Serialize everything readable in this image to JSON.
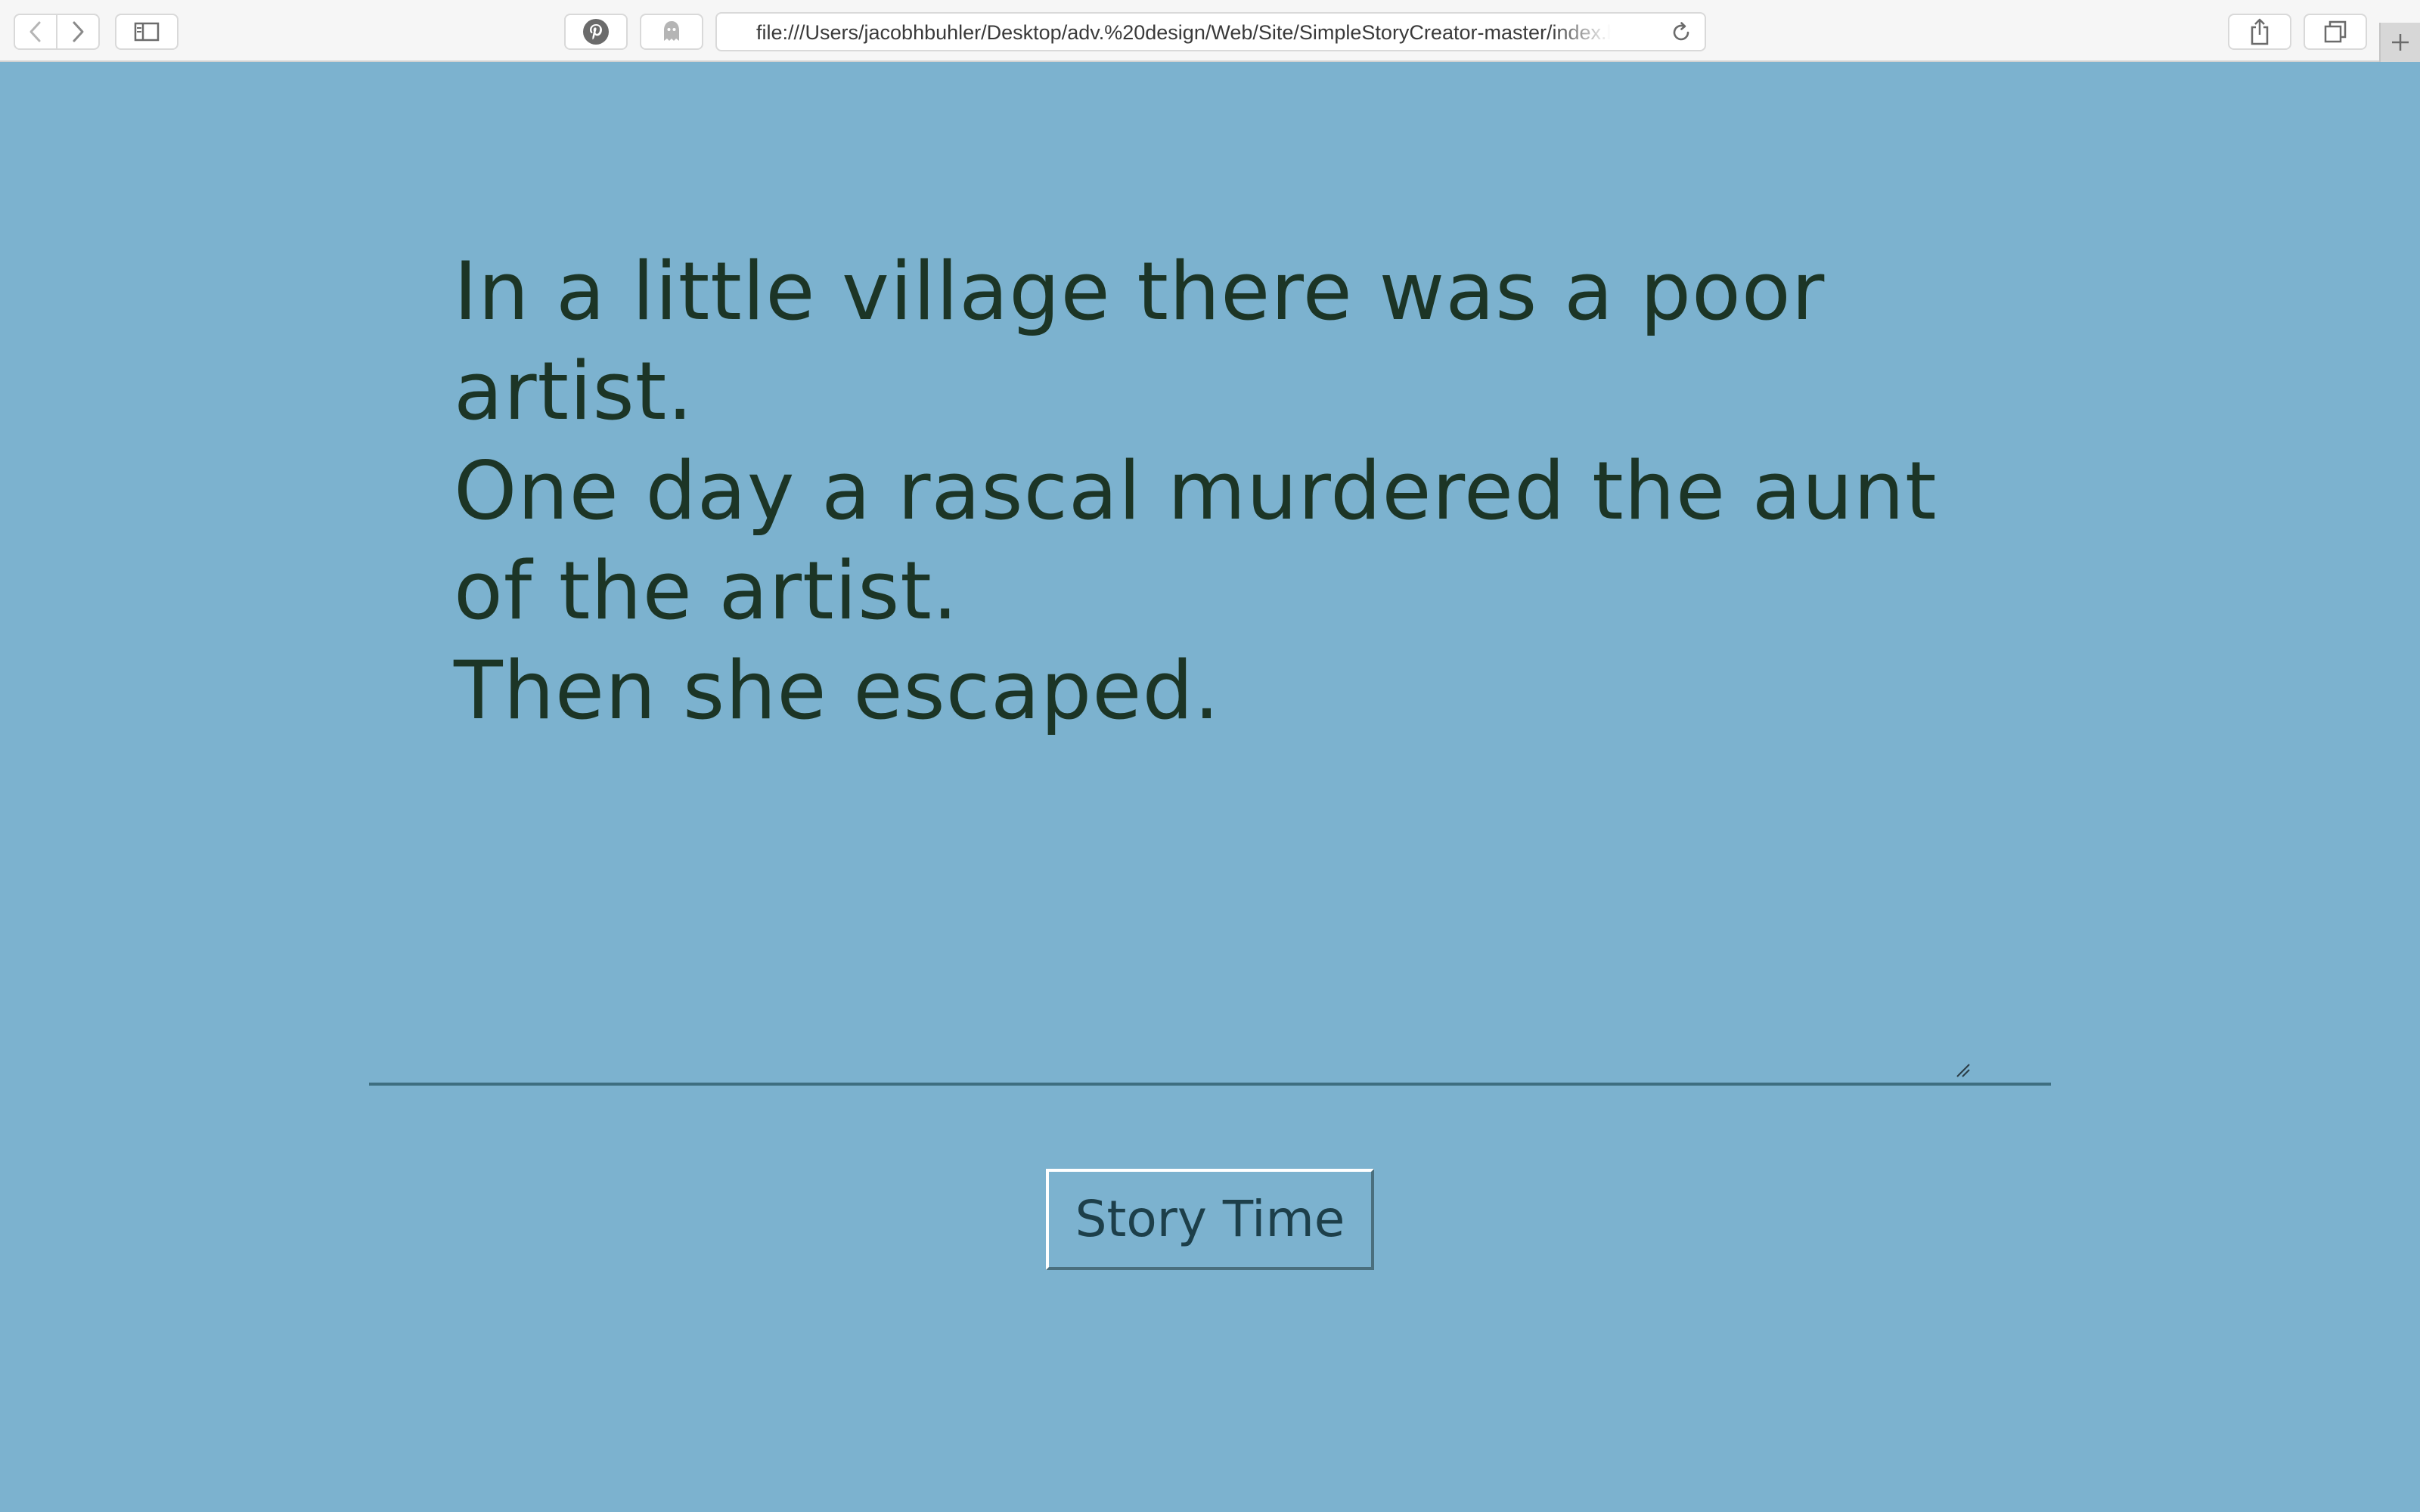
{
  "browser": {
    "url": "file:///Users/jacobhbuhler/Desktop/adv.%20design/Web/Site/SimpleStoryCreator-master/index.html",
    "icons": {
      "back": "chevron-left-icon",
      "forward": "chevron-right-icon",
      "sidebar": "sidebar-icon",
      "pinterest": "pinterest-icon",
      "ghost": "ghostery-icon",
      "reload": "reload-icon",
      "share": "share-icon",
      "tabs": "tabs-overview-icon",
      "new_tab": "plus-icon"
    }
  },
  "page": {
    "background_color": "#7cb2cf",
    "text_color": "#1c3526",
    "story_lines": [
      "In a little village there was a poor artist.",
      "One day a rascal murdered the aunt of the artist.",
      "Then she escaped."
    ],
    "button_label": "Story Time"
  }
}
